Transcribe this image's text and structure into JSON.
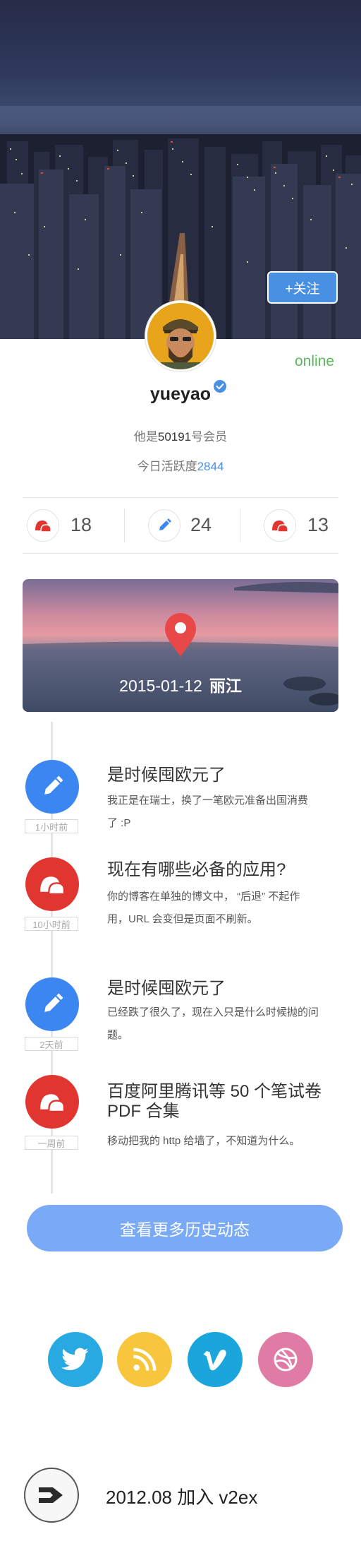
{
  "header": {
    "follow_label": "+关注"
  },
  "profile": {
    "status": "online",
    "username": "yueyao",
    "member_prefix": "他是",
    "member_number": "50191",
    "member_suffix": "号会员",
    "activity_label": "今日活跃度",
    "activity_value": "2844"
  },
  "stats": [
    {
      "icon": "speech-bubble-icon",
      "count": "18"
    },
    {
      "icon": "pencil-icon",
      "count": "24"
    },
    {
      "icon": "speech-bubble-icon",
      "count": "13"
    }
  ],
  "location": {
    "date": "2015-01-12",
    "city": "丽江"
  },
  "timeline": [
    {
      "type": "pencil",
      "time": "1小时前",
      "title": "是时候囤欧元了",
      "desc_lines": [
        "我正是在瑞士，换了一笔欧元准备出国消费",
        "了 :P"
      ]
    },
    {
      "type": "bubble",
      "time": "10小时前",
      "title": "现在有哪些必备的应用?",
      "desc_lines": [
        "你的博客在单独的博文中，  “后退”  不起作",
        "用，URL 会变但是页面不刷新。"
      ]
    },
    {
      "type": "pencil",
      "time": "2天前",
      "title": "是时候囤欧元了",
      "desc_lines": [
        "已经跌了很久了，现在入只是什么时候抛的问",
        "题。"
      ]
    },
    {
      "type": "bubble",
      "time": "一周前",
      "title_lines": [
        "百度阿里腾讯等 50 个笔试卷",
        "PDF 合集"
      ],
      "desc_lines": [
        "移动把我的 http 给墙了，不知道为什么。"
      ]
    }
  ],
  "more_label": "查看更多历史动态",
  "social": [
    {
      "name": "twitter",
      "icon": "twitter-icon",
      "color": "#29a9e1"
    },
    {
      "name": "rss",
      "icon": "rss-icon",
      "color": "#f8c63d"
    },
    {
      "name": "vimeo",
      "icon": "vimeo-icon",
      "color": "#1aa6dd"
    },
    {
      "name": "dribbble",
      "icon": "dribbble-icon",
      "color": "#e07ba5"
    }
  ],
  "join": {
    "text": "2012.08 加入 v2ex"
  },
  "colors": {
    "accent": "#4a90e2",
    "online": "#5cb85c",
    "blue_event": "#3b86f0",
    "red_event": "#e1362f",
    "more_button": "#7aaaf6"
  }
}
